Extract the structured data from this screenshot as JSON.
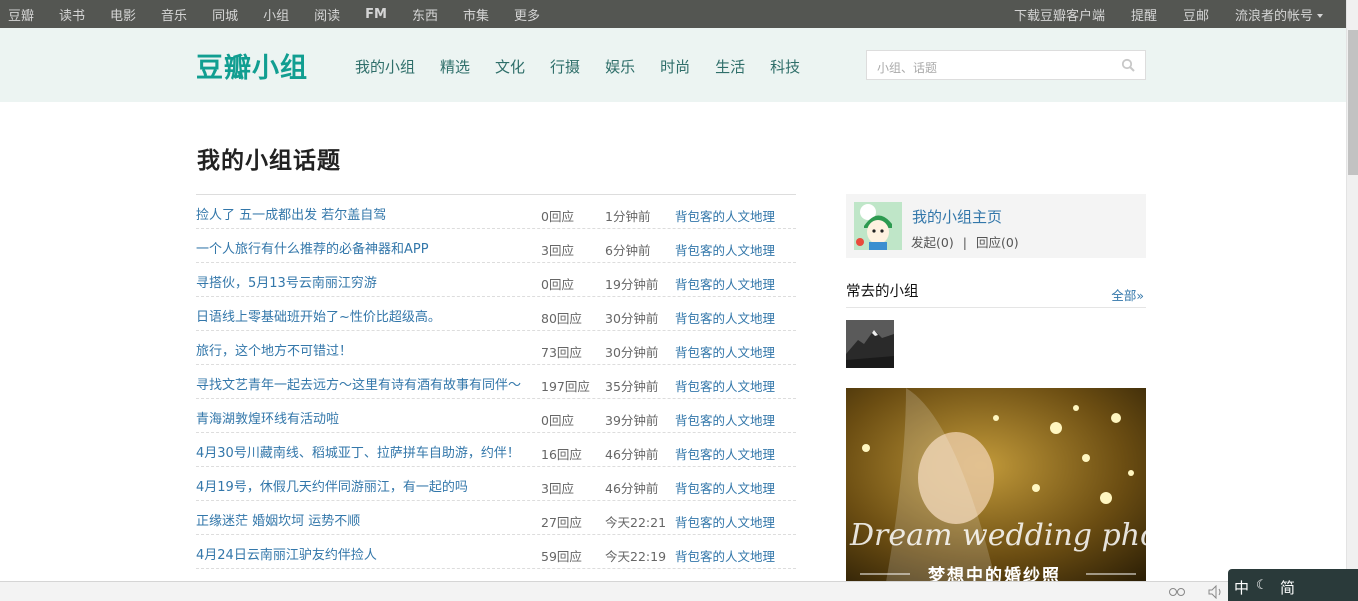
{
  "topbar": {
    "left": [
      "豆瓣",
      "读书",
      "电影",
      "音乐",
      "同城",
      "小组",
      "阅读",
      "FM",
      "东西",
      "市集",
      "更多"
    ],
    "right": {
      "download": "下载豆瓣客户端",
      "remind": "提醒",
      "mail": "豆邮",
      "account": "流浪者的帐号"
    }
  },
  "header": {
    "logo": "豆瓣小组",
    "nav": [
      "我的小组",
      "精选",
      "文化",
      "行摄",
      "娱乐",
      "时尚",
      "生活",
      "科技"
    ],
    "search_placeholder": "小组、话题"
  },
  "main": {
    "title": "我的小组话题",
    "topics": [
      {
        "title": "捡人了 五一成都出发 若尔盖自驾",
        "replies": "0回应",
        "time": "1分钟前",
        "group": "背包客的人文地理"
      },
      {
        "title": "一个人旅行有什么推荐的必备神器和APP",
        "replies": "3回应",
        "time": "6分钟前",
        "group": "背包客的人文地理"
      },
      {
        "title": "寻搭伙，5月13号云南丽江穷游",
        "replies": "0回应",
        "time": "19分钟前",
        "group": "背包客的人文地理"
      },
      {
        "title": "日语线上零基础班开始了~性价比超级高。",
        "replies": "80回应",
        "time": "30分钟前",
        "group": "背包客的人文地理"
      },
      {
        "title": "旅行，这个地方不可错过！",
        "replies": "73回应",
        "time": "30分钟前",
        "group": "背包客的人文地理"
      },
      {
        "title": "寻找文艺青年一起去远方～这里有诗有酒有故事有同伴～",
        "replies": "197回应",
        "time": "35分钟前",
        "group": "背包客的人文地理"
      },
      {
        "title": "青海湖敦煌环线有活动啦",
        "replies": "0回应",
        "time": "39分钟前",
        "group": "背包客的人文地理"
      },
      {
        "title": "4月30号川藏南线、稻城亚丁、拉萨拼车自助游，约伴！",
        "replies": "16回应",
        "time": "46分钟前",
        "group": "背包客的人文地理"
      },
      {
        "title": "4月19号，休假几天约伴同游丽江，有一起的吗",
        "replies": "3回应",
        "time": "46分钟前",
        "group": "背包客的人文地理"
      },
      {
        "title": "正缘迷茫 婚姻坎坷 运势不顺",
        "replies": "27回应",
        "time": "今天22:21",
        "group": "背包客的人文地理"
      },
      {
        "title": "4月24日云南丽江驴友约伴捡人",
        "replies": "59回应",
        "time": "今天22:19",
        "group": "背包客的人文地理"
      }
    ]
  },
  "sidebar": {
    "profile": {
      "name": "我的小组主页",
      "posts": "发起(0)",
      "sep": "|",
      "replies": "回应(0)"
    },
    "frequent": {
      "heading": "常去的小组",
      "all": "全部»"
    },
    "ad": {
      "text_en": "Dream wedding photos",
      "text_cn": "梦想中的婚纱照"
    }
  },
  "ime": {
    "lang": "中",
    "mode": "简"
  },
  "colors": {
    "topbar": "#545652",
    "header_bg": "#ecf4f2",
    "logo": "#119e91",
    "link": "#3377aa"
  }
}
